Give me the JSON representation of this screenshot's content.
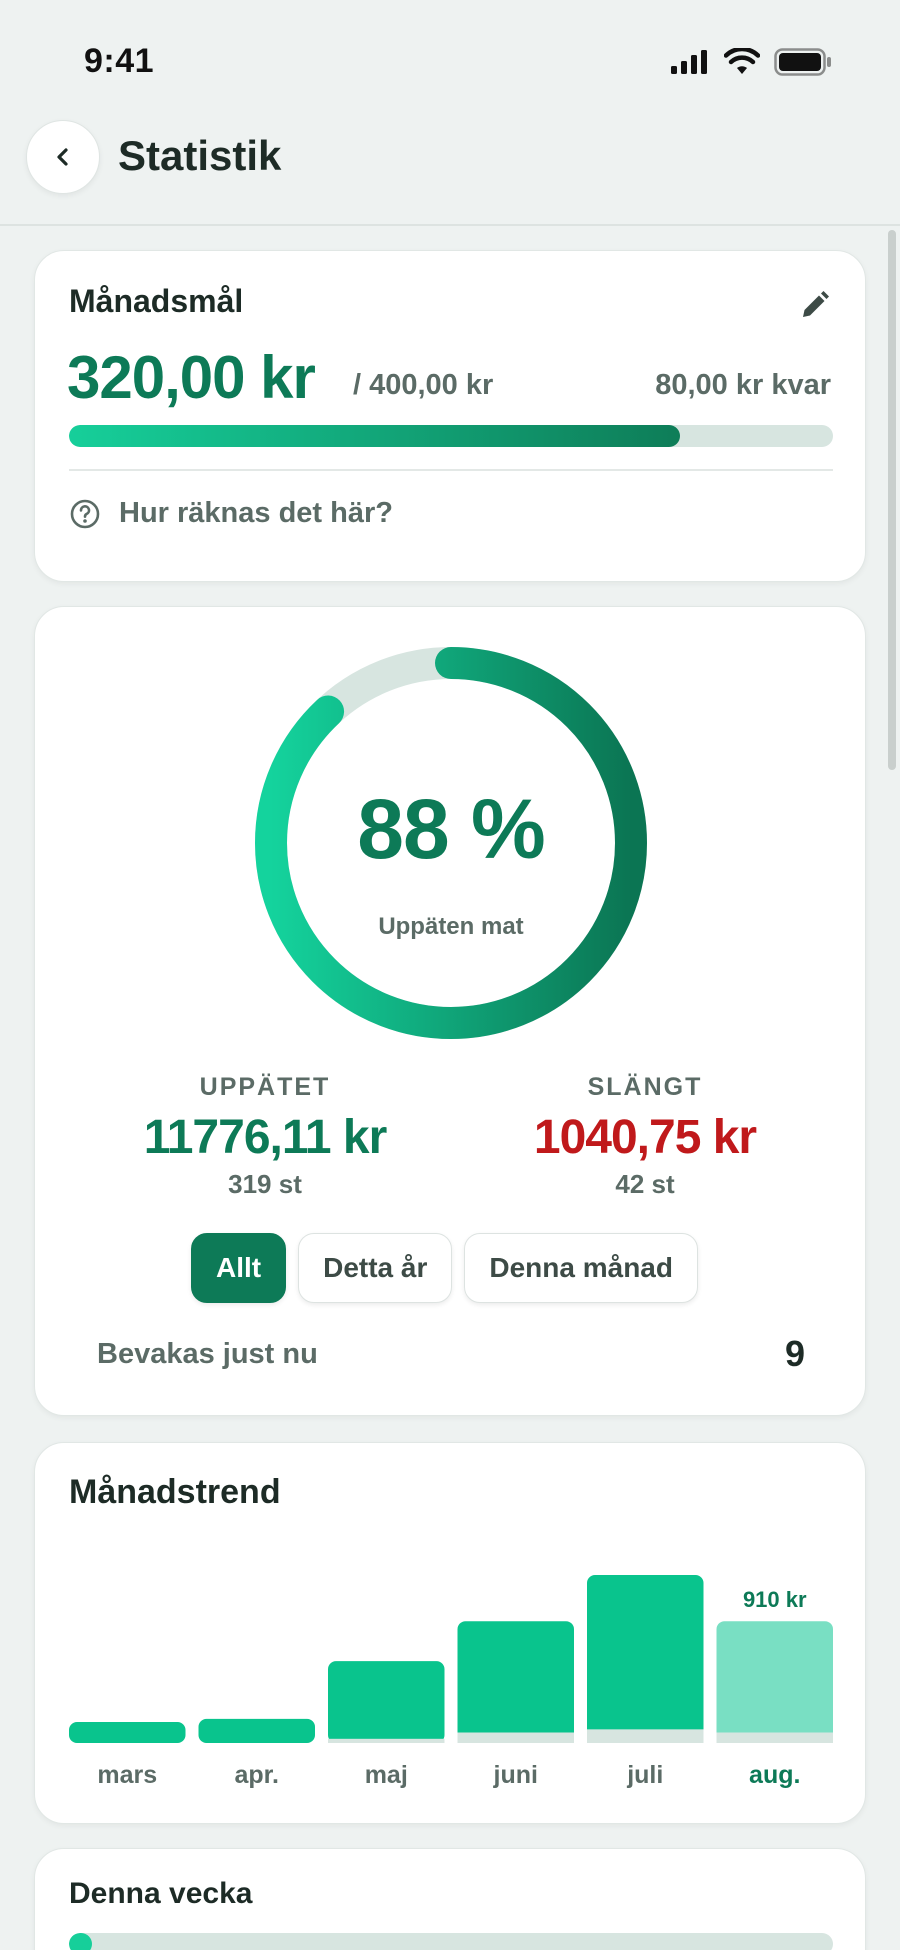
{
  "status_bar": {
    "time": "9:41",
    "icons": [
      "signal-icon",
      "wifi-icon",
      "battery-icon"
    ]
  },
  "header": {
    "back_icon": "chevron-left-icon",
    "title": "Statistik"
  },
  "goal": {
    "title": "Månadsmål",
    "edit_icon": "pencil-icon",
    "amount": "320,00 kr",
    "target": "/ 400,00 kr",
    "remaining": "80,00 kr kvar",
    "progress": 0.8,
    "help_icon": "question-circle-icon",
    "help_label": "Hur räknas det här?"
  },
  "stats": {
    "percent_value": 88,
    "percent": "88 %",
    "percent_label": "Uppäten mat",
    "eaten": {
      "heading": "UPPÄTET",
      "amount": "11776,11 kr",
      "count": "319 st"
    },
    "wasted": {
      "heading": "SLÄNGT",
      "amount": "1040,75 kr",
      "count": "42 st"
    },
    "filters": [
      {
        "label": "Allt",
        "active": true
      },
      {
        "label": "Detta år",
        "active": false
      },
      {
        "label": "Denna månad",
        "active": false
      }
    ],
    "watch_label": "Bevakas just nu",
    "watch_count": "9"
  },
  "trend": {
    "title": "Månadstrend",
    "highlight_value": "910 kr"
  },
  "chart_data": {
    "type": "bar",
    "title": "Månadstrend",
    "categories": [
      "mars",
      "apr.",
      "maj",
      "juni",
      "juli",
      "aug."
    ],
    "values": [
      200,
      230,
      780,
      1160,
      1600,
      1160
    ],
    "series": [
      {
        "values": [
          200,
          230,
          780,
          1160,
          1600,
          1160
        ]
      },
      {
        "values": [
          0,
          0,
          40,
          100,
          130,
          100
        ]
      }
    ],
    "active_index": 5,
    "data_labels": {
      "aug.": "910 kr"
    },
    "ylim": [
      0,
      1600
    ],
    "grid": false
  },
  "week": {
    "title": "Denna vecka",
    "progress": 0.03
  },
  "colors": {
    "accent": "#0d7a57",
    "accent_light": "#16cf9a",
    "bar": "#09c48d",
    "bar_active": "#79dfc3",
    "bar_base": "#d7e5e0",
    "danger": "#c0191b",
    "muted_text": "#5b6b66",
    "background": "#eef2f1"
  }
}
